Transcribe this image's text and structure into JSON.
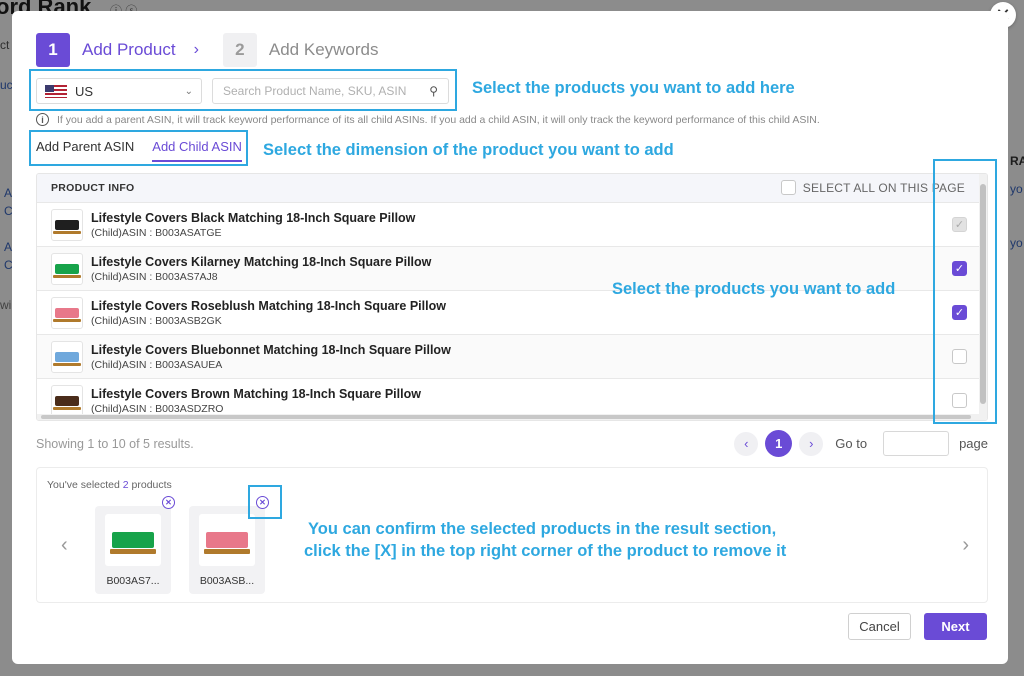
{
  "background": {
    "page_title": "ord Rank",
    "fragments": [
      "ct",
      "uc",
      "A",
      "C",
      "A",
      "C",
      "wi",
      "RA",
      "yo",
      "yo"
    ]
  },
  "stepper": {
    "step1_num": "1",
    "step1_label": "Add Product",
    "step2_num": "2",
    "step2_label": "Add Keywords"
  },
  "country": {
    "label": "US"
  },
  "search": {
    "placeholder": "Search Product Name, SKU, ASIN",
    "value": ""
  },
  "info_text": "If you add a parent ASIN, it will track keyword performance of its all child ASINs. If you add a child ASIN, it will only track the keyword performance of this child ASIN.",
  "tabs": {
    "parent": "Add Parent ASIN",
    "child": "Add Child ASIN"
  },
  "table": {
    "header": "PRODUCT INFO",
    "select_all": "SELECT ALL ON THIS PAGE",
    "rows": [
      {
        "name": "Lifestyle Covers Black Matching 18-Inch Square Pillow",
        "asin": "(Child)ASIN : B003ASATGE",
        "color": "#1f1f1f",
        "state": "disabled"
      },
      {
        "name": "Lifestyle Covers Kilarney Matching 18-Inch Square Pillow",
        "asin": "(Child)ASIN : B003AS7AJ8",
        "color": "#17a34a",
        "state": "checked"
      },
      {
        "name": "Lifestyle Covers Roseblush Matching 18-Inch Square Pillow",
        "asin": "(Child)ASIN : B003ASB2GK",
        "color": "#e8788a",
        "state": "checked"
      },
      {
        "name": "Lifestyle Covers Bluebonnet Matching 18-Inch Square Pillow",
        "asin": "(Child)ASIN : B003ASAUEA",
        "color": "#6fa8dc",
        "state": "unchecked"
      },
      {
        "name": "Lifestyle Covers Brown Matching 18-Inch Square Pillow",
        "asin": "(Child)ASIN : B003ASDZRO",
        "color": "#4a2c1a",
        "state": "unchecked"
      }
    ]
  },
  "pagination": {
    "showing": "Showing 1 to 10 of 5 results.",
    "prev": "‹",
    "current": "1",
    "next": "›",
    "goto": "Go to",
    "page": "page"
  },
  "selected": {
    "prefix": "You've selected ",
    "count": "2",
    "suffix": " products",
    "items": [
      {
        "label": "B003AS7...",
        "color": "#17a34a"
      },
      {
        "label": "B003ASB...",
        "color": "#e8788a"
      }
    ]
  },
  "callouts": {
    "c1": "Select the products you want to add here",
    "c2": "Select the dimension of the product you want to add",
    "c3": "Select the products you want to add",
    "c4_line1": "You can confirm the selected products in the result section,",
    "c4_line2": "click the [X] in the top right corner of the product to remove it"
  },
  "buttons": {
    "cancel": "Cancel",
    "next": "Next"
  },
  "colors": {
    "accent": "#6a4bd6",
    "callout": "#2ea8e0"
  }
}
